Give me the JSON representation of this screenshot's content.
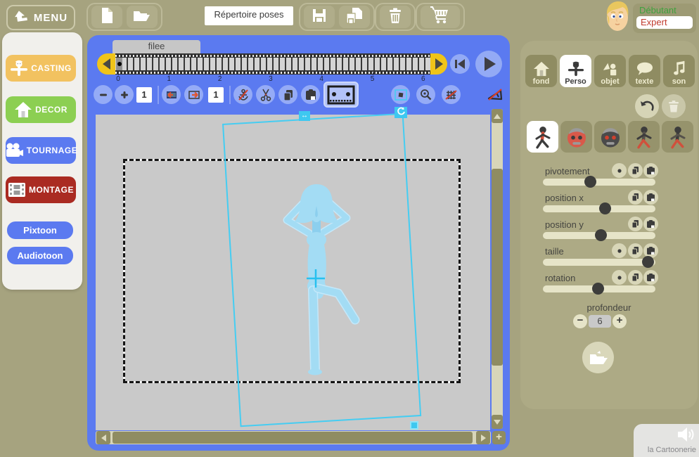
{
  "top_bar": {
    "menu_label": "MENU",
    "poses_button_label": "Répertoire poses",
    "icons": [
      "new-document-icon",
      "open-folder-icon",
      "save-icon",
      "save-copy-icon",
      "trash-icon",
      "cart-icon"
    ],
    "user": {
      "level_top": "Débutant",
      "level_selected": "Expert"
    }
  },
  "sidebar": {
    "items": [
      {
        "label": "CASTING",
        "color": "#f2c260",
        "icon": "scarecrow-icon"
      },
      {
        "label": "DECOR",
        "color": "#8ccf52",
        "icon": "house-icon"
      },
      {
        "label": "TOURNAGE",
        "color": "#5b7af0",
        "icon": "movie-camera-icon"
      },
      {
        "label": "MONTAGE",
        "color": "#aa2b22",
        "icon": "filmstrip-icon"
      }
    ],
    "tools": [
      {
        "label": "Pixtoon",
        "color": "#5b7af0"
      },
      {
        "label": "Audiotoon",
        "color": "#5b7af0"
      }
    ]
  },
  "timeline": {
    "tab_label": "filee",
    "numbers": [
      "0",
      "1",
      "2",
      "3",
      "4",
      "5",
      "6"
    ],
    "current_frame": 0
  },
  "edit_toolbar": {
    "frame_count": "1",
    "insert_count": "1"
  },
  "right_panel": {
    "tabs": [
      {
        "label": "fond",
        "icon": "house-icon",
        "selected": false
      },
      {
        "label": "Perso",
        "icon": "scarecrow-icon",
        "selected": true
      },
      {
        "label": "objet",
        "icon": "shapes-icon",
        "selected": false
      },
      {
        "label": "texte",
        "icon": "speech-bubble-icon",
        "selected": false
      },
      {
        "label": "son",
        "icon": "music-note-icon",
        "selected": false
      }
    ],
    "characters": [
      {
        "name": "stick-red-torso",
        "type": "stick",
        "selected": true,
        "head": "#3c3c3c",
        "torso": "#d0503c",
        "arms": "#3c3c3c",
        "legs": "#3c3c3c",
        "bg": "#ffffff"
      },
      {
        "name": "pumpkin-red-face",
        "type": "pumpkin",
        "selected": false,
        "face": "#d9594a",
        "eyes": "#3c3c3c",
        "cap": "#9a9a9a"
      },
      {
        "name": "pumpkin-dark-face",
        "type": "pumpkin",
        "selected": false,
        "face": "#4a4a4a",
        "eyes": "#d0402e",
        "cap": "#9a9a9a"
      },
      {
        "name": "stick-red-leg",
        "type": "stick",
        "selected": false,
        "head": "#3c3c3c",
        "torso": "#55514b",
        "arms": "#3c3c3c",
        "legs": "#d0503c",
        "bg": ""
      },
      {
        "name": "stick-red-legs",
        "type": "stick",
        "selected": false,
        "head": "#3c3c3c",
        "torso": "#3c3c3c",
        "arms": "#55514b",
        "legs": "#d0503c",
        "bg": ""
      }
    ],
    "sliders": [
      {
        "label": "pivotement",
        "value_pct": 42,
        "reset_button": true
      },
      {
        "label": "position x",
        "value_pct": 55,
        "reset_button": false
      },
      {
        "label": "position y",
        "value_pct": 51,
        "reset_button": false
      },
      {
        "label": "taille",
        "value_pct": 93,
        "reset_button": true
      },
      {
        "label": "rotation",
        "value_pct": 49,
        "reset_button": true
      }
    ],
    "depth": {
      "label": "profondeur",
      "value": "6"
    }
  },
  "footer": {
    "brand": "la Cartoonerie"
  },
  "colors": {
    "background_olive": "#a6a37f",
    "window_blue": "#5b7af0",
    "toolbar_circle_blue": "#95abf6",
    "timeline_yellow": "#f0c419",
    "selection_cyan": "#45cdf2",
    "figure_blue": "#a3dcf4",
    "canvas_gray": "#c9c9c9",
    "scrollbar_olive": "#8f8c62",
    "level_green": "#3da23d",
    "level_red": "#c13a2c"
  }
}
